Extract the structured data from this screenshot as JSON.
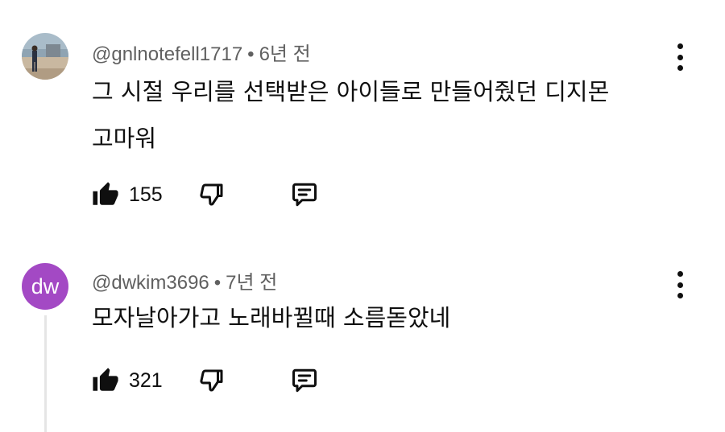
{
  "comments": [
    {
      "author": "@gnlnotefell1717",
      "separator": "•",
      "time": "6년 전",
      "text_lines": [
        "그 시절 우리를 선택받은 아이들로 만들어줬던 디지몬",
        "고마워"
      ],
      "likes": "155",
      "avatar_type": "photo"
    },
    {
      "author": "@dwkim3696",
      "separator": "•",
      "time": "7년 전",
      "text_lines": [
        "모자날아가고 노래바뀔때 소름돋았네"
      ],
      "likes": "321",
      "avatar_type": "letters",
      "avatar_letters": "dw",
      "avatar_color": "#a349c4"
    }
  ],
  "icons": {
    "like": "thumbs-up-icon",
    "dislike": "thumbs-down-icon",
    "reply": "reply-icon",
    "menu": "more-vert-icon"
  }
}
